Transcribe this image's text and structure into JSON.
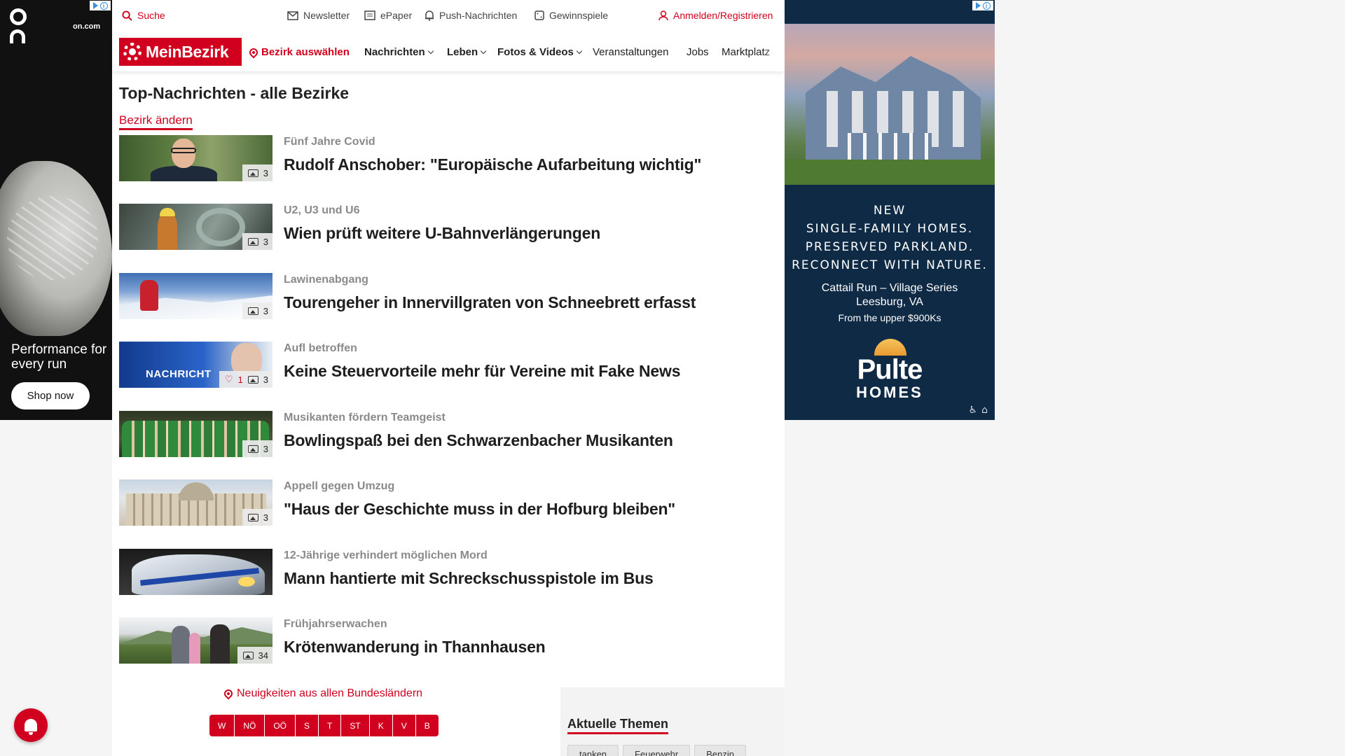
{
  "colors": {
    "brand_red": "#d1001f",
    "ad_right_bg": "#0f2a45"
  },
  "ad_left": {
    "site": "on.com",
    "headline": "Performance for every run",
    "cta": "Shop now",
    "logo_icon": "on-logo-icon"
  },
  "topbar": {
    "search": "Suche",
    "newsletter": "Newsletter",
    "epaper": "ePaper",
    "push": "Push-Nachrichten",
    "games": "Gewinnspiele",
    "login": "Anmelden/Registrieren"
  },
  "navbar": {
    "brand": "MeinBezirk",
    "district": "Bezirk auswählen",
    "items": [
      "Nachrichten",
      "Leben",
      "Fotos & Videos",
      "Veranstaltungen",
      "Jobs",
      "Marktplatz"
    ]
  },
  "page": {
    "title": "Top-Nachrichten - alle Bezirke",
    "change_district": "Bezirk ändern"
  },
  "articles": [
    {
      "kicker": "Fünf Jahre Covid",
      "headline": "Rudolf Anschober: \"Europäische Aufarbeitung wichtig\"",
      "photos": "3",
      "likes": ""
    },
    {
      "kicker": "U2, U3 und U6",
      "headline": "Wien prüft weitere U-Bahnverlängerungen",
      "photos": "3",
      "likes": ""
    },
    {
      "kicker": "Lawinenabgang",
      "headline": "Tourengeher in Innervillgraten von Schneebrett erfasst",
      "photos": "3",
      "likes": ""
    },
    {
      "kicker": "Aufl betroffen",
      "headline": "Keine Steuervorteile mehr für Vereine mit Fake News",
      "photos": "3",
      "likes": "1",
      "thumb_text": "NACHRICHT"
    },
    {
      "kicker": "Musikanten fördern Teamgeist",
      "headline": "Bowlingspaß bei den Schwarzenbacher Musikanten",
      "photos": "3",
      "likes": ""
    },
    {
      "kicker": "Appell gegen Umzug",
      "headline": "\"Haus der Geschichte muss in der Hofburg bleiben\"",
      "photos": "3",
      "likes": ""
    },
    {
      "kicker": "12-Jährige verhindert möglichen Mord",
      "headline": "Mann hantierte mit Schreckschusspistole im Bus",
      "photos": "",
      "likes": ""
    },
    {
      "kicker": "Frühjahrserwachen",
      "headline": "Krötenwanderung in Thannhausen",
      "photos": "34",
      "likes": ""
    }
  ],
  "bottom": {
    "states_link": "Neuigkeiten aus allen Bundesländern",
    "states": [
      "W",
      "NÖ",
      "OÖ",
      "S",
      "T",
      "ST",
      "K",
      "V",
      "B"
    ],
    "topics_title": "Aktuelle Themen",
    "topics": [
      "tanken",
      "Feuerwehr",
      "Benzin"
    ]
  },
  "ad_right": {
    "line1": "NEW",
    "line2": "SINGLE-FAMILY HOMES.",
    "line3": "PRESERVED PARKLAND.",
    "line4": "RECONNECT WITH NATURE.",
    "project": "Cattail Run – Village Series",
    "location": "Leesburg, VA",
    "price": "From the upper $900Ks",
    "brand": "Pulte",
    "brand_sub": "HOMES"
  }
}
